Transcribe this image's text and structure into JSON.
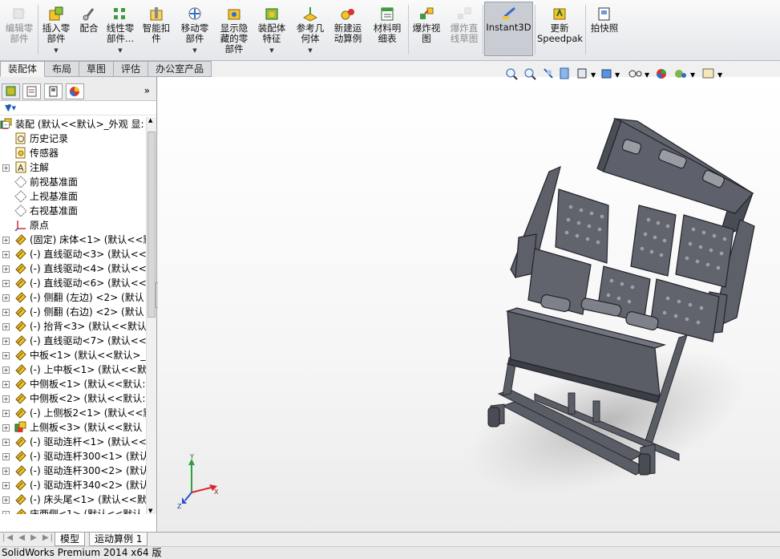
{
  "ribbon": {
    "buttons": [
      {
        "label": "编辑零\n部件",
        "disabled": true,
        "icon": "edit-component-icon"
      },
      {
        "label": "插入零\n部件",
        "dropdown": true,
        "icon": "insert-component-icon"
      },
      {
        "label": "配合",
        "icon": "mate-icon"
      },
      {
        "label": "线性零\n部件...",
        "dropdown": true,
        "icon": "linear-pattern-icon"
      },
      {
        "label": "智能扣\n件",
        "icon": "smart-fastener-icon"
      },
      {
        "label": "移动零\n部件",
        "dropdown": true,
        "icon": "move-component-icon"
      },
      {
        "label": "显示隐\n藏的零\n部件",
        "icon": "show-hidden-icon"
      },
      {
        "label": "装配体\n特征",
        "dropdown": true,
        "icon": "assembly-feature-icon"
      },
      {
        "label": "参考几\n何体",
        "dropdown": true,
        "icon": "reference-geometry-icon"
      },
      {
        "label": "新建运\n动算例",
        "icon": "new-motion-study-icon"
      },
      {
        "label": "材料明\n细表",
        "icon": "bom-icon"
      },
      {
        "label": "爆炸视\n图",
        "icon": "exploded-view-icon"
      },
      {
        "label": "爆炸直\n线草图",
        "disabled": true,
        "icon": "explode-line-sketch-icon"
      },
      {
        "label": "Instant3D",
        "active": true,
        "icon": "instant3d-icon"
      },
      {
        "label": "更新\nSpeedpak",
        "icon": "speedpak-icon"
      },
      {
        "label": "拍快照",
        "icon": "snapshot-icon"
      }
    ]
  },
  "tabs": [
    "装配体",
    "布局",
    "草图",
    "评估",
    "办公室产品"
  ],
  "tree": [
    {
      "label": "装配  (默认<<默认>_外观 显:",
      "icon": "assembly-icon",
      "toggle": "-"
    },
    {
      "label": "历史记录",
      "icon": "history-icon",
      "toggle": ""
    },
    {
      "label": "传感器",
      "icon": "sensor-icon",
      "toggle": ""
    },
    {
      "label": "注解",
      "icon": "annotation-icon",
      "toggle": "+"
    },
    {
      "label": "前视基准面",
      "icon": "plane-icon",
      "toggle": ""
    },
    {
      "label": "上视基准面",
      "icon": "plane-icon",
      "toggle": ""
    },
    {
      "label": "右视基准面",
      "icon": "plane-icon",
      "toggle": ""
    },
    {
      "label": "原点",
      "icon": "origin-icon",
      "toggle": ""
    },
    {
      "label": "(固定) 床体<1> (默认<<默",
      "icon": "part-icon",
      "toggle": "+"
    },
    {
      "label": "(-) 直线驱动<3> (默认<<",
      "icon": "part-icon",
      "toggle": "+"
    },
    {
      "label": "(-) 直线驱动<4> (默认<<",
      "icon": "part-icon",
      "toggle": "+"
    },
    {
      "label": "(-) 直线驱动<6> (默认<<",
      "icon": "part-icon",
      "toggle": "+"
    },
    {
      "label": "(-) 侧翻 (左边) <2> (默认",
      "icon": "part-icon",
      "toggle": "+"
    },
    {
      "label": "(-) 侧翻 (右边) <2> (默认",
      "icon": "part-icon",
      "toggle": "+"
    },
    {
      "label": "(-) 抬背<3> (默认<<默认",
      "icon": "part-icon",
      "toggle": "+"
    },
    {
      "label": "(-) 直线驱动<7> (默认<<",
      "icon": "part-icon",
      "toggle": "+"
    },
    {
      "label": "中板<1> (默认<<默认>_",
      "icon": "part-icon",
      "toggle": "+"
    },
    {
      "label": "(-) 上中板<1> (默认<<默",
      "icon": "part-icon",
      "toggle": "+"
    },
    {
      "label": "中侧板<1> (默认<<默认:",
      "icon": "part-icon",
      "toggle": "+"
    },
    {
      "label": "中侧板<2> (默认<<默认:",
      "icon": "part-icon",
      "toggle": "+"
    },
    {
      "label": "(-) 上侧板2<1> (默认<<默",
      "icon": "part-icon",
      "toggle": "+"
    },
    {
      "label": "上侧板<3> (默认<<默认",
      "icon": "assembly-icon",
      "toggle": "+"
    },
    {
      "label": "(-) 驱动连杆<1> (默认<<",
      "icon": "part-icon",
      "toggle": "+"
    },
    {
      "label": "(-) 驱动连杆300<1> (默认",
      "icon": "part-icon",
      "toggle": "+"
    },
    {
      "label": "(-) 驱动连杆300<2> (默认",
      "icon": "part-icon",
      "toggle": "+"
    },
    {
      "label": "(-) 驱动连杆340<2> (默认",
      "icon": "part-icon",
      "toggle": "+"
    },
    {
      "label": "(-) 床头尾<1> (默认<<默",
      "icon": "part-icon",
      "toggle": "+"
    },
    {
      "label": "床两侧<1> (默认<<默认",
      "icon": "part-icon",
      "toggle": "+"
    }
  ],
  "bottom_tabs": [
    "模型",
    "运动算例 1"
  ],
  "status": "SolidWorks Premium 2014 x64 版",
  "triad": {
    "x": "X",
    "y": "Y",
    "z": "Z"
  },
  "colors": {
    "model": "#5b5d66",
    "model_top": "#6a6d78"
  }
}
